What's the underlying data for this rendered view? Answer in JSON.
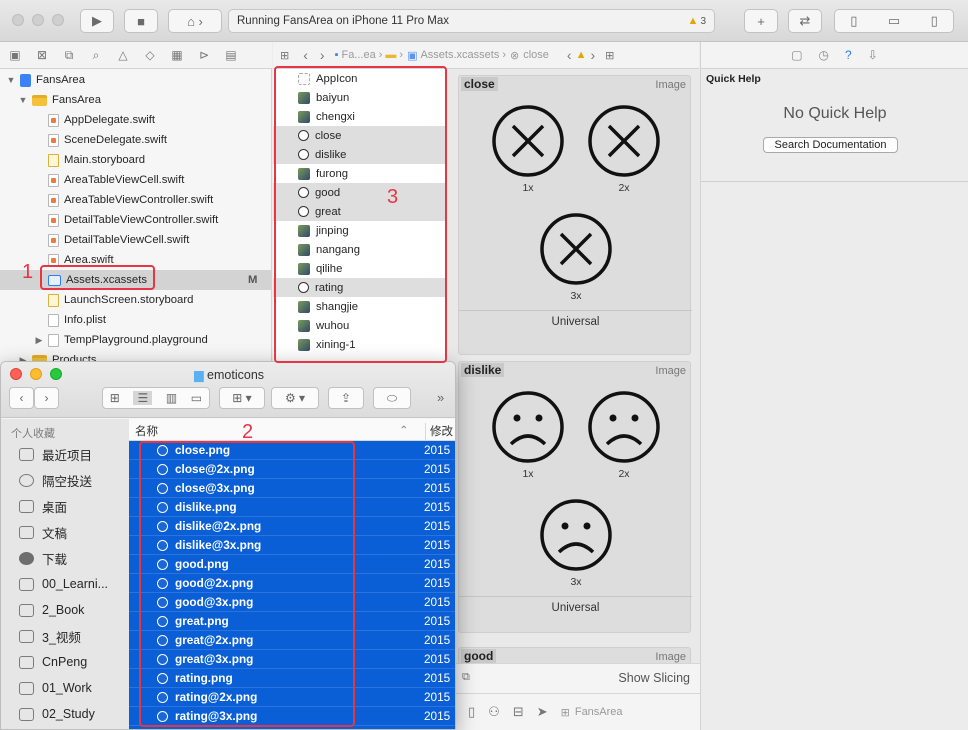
{
  "toolbar": {
    "status_text": "Running FansArea on iPhone 11 Pro Max",
    "warning_count": "3",
    "run_icon": "play-icon",
    "stop_icon": "stop-icon"
  },
  "navigator": {
    "items": [
      {
        "label": "FansArea",
        "kind": "project"
      },
      {
        "label": "FansArea",
        "kind": "group"
      },
      {
        "label": "AppDelegate.swift",
        "kind": "swift"
      },
      {
        "label": "SceneDelegate.swift",
        "kind": "swift"
      },
      {
        "label": "Main.storyboard",
        "kind": "storyboard"
      },
      {
        "label": "AreaTableViewCell.swift",
        "kind": "swift"
      },
      {
        "label": "AreaTableViewController.swift",
        "kind": "swift"
      },
      {
        "label": "DetailTableViewController.swift",
        "kind": "swift"
      },
      {
        "label": "DetailTableViewCell.swift",
        "kind": "swift"
      },
      {
        "label": "Area.swift",
        "kind": "swift"
      },
      {
        "label": "Assets.xcassets",
        "kind": "assets",
        "badge": "M"
      },
      {
        "label": "LaunchScreen.storyboard",
        "kind": "storyboard"
      },
      {
        "label": "Info.plist",
        "kind": "plist"
      },
      {
        "label": "TempPlayground.playground",
        "kind": "playground"
      },
      {
        "label": "Products",
        "kind": "group"
      }
    ]
  },
  "editor": {
    "breadcrumb": [
      "Fa...ea",
      "Assets.xcassets",
      "close"
    ]
  },
  "assets": [
    {
      "label": "AppIcon",
      "thumb": "blank"
    },
    {
      "label": "baiyun",
      "thumb": "img"
    },
    {
      "label": "chengxi",
      "thumb": "img"
    },
    {
      "label": "close",
      "thumb": "face",
      "highlight": true
    },
    {
      "label": "dislike",
      "thumb": "face",
      "highlight": true
    },
    {
      "label": "furong",
      "thumb": "img"
    },
    {
      "label": "good",
      "thumb": "face",
      "highlight": true
    },
    {
      "label": "great",
      "thumb": "face",
      "highlight": true
    },
    {
      "label": "jinping",
      "thumb": "img"
    },
    {
      "label": "nangang",
      "thumb": "img"
    },
    {
      "label": "qilihe",
      "thumb": "img"
    },
    {
      "label": "rating",
      "thumb": "face",
      "highlight": true
    },
    {
      "label": "shangjie",
      "thumb": "img"
    },
    {
      "label": "wuhou",
      "thumb": "img"
    },
    {
      "label": "xining-1",
      "thumb": "img"
    }
  ],
  "detail": {
    "sets": [
      {
        "name": "close",
        "type": "Image",
        "slots": [
          "1x",
          "2x",
          "3x"
        ],
        "scope": "Universal"
      },
      {
        "name": "dislike",
        "type": "Image",
        "slots": [
          "1x",
          "2x",
          "3x"
        ],
        "scope": "Universal"
      },
      {
        "name": "good",
        "type": "Image"
      }
    ],
    "show_slicing": "Show Slicing",
    "footer_project": "FansArea"
  },
  "inspector": {
    "title": "Quick Help",
    "empty_text": "No Quick Help",
    "search_button": "Search Documentation"
  },
  "finder": {
    "title": "emoticons",
    "sidebar_section": "个人收藏",
    "sidebar": [
      "最近项目",
      "隔空投送",
      "桌面",
      "文稿",
      "下载",
      "00_Learni...",
      "2_Book",
      "3_视频",
      "CnPeng",
      "01_Work",
      "02_Study"
    ],
    "columns": {
      "name": "名称",
      "date": "修改日"
    },
    "files": [
      {
        "name": "close.png",
        "date": "2015"
      },
      {
        "name": "close@2x.png",
        "date": "2015"
      },
      {
        "name": "close@3x.png",
        "date": "2015"
      },
      {
        "name": "dislike.png",
        "date": "2015"
      },
      {
        "name": "dislike@2x.png",
        "date": "2015"
      },
      {
        "name": "dislike@3x.png",
        "date": "2015"
      },
      {
        "name": "good.png",
        "date": "2015"
      },
      {
        "name": "good@2x.png",
        "date": "2015"
      },
      {
        "name": "good@3x.png",
        "date": "2015"
      },
      {
        "name": "great.png",
        "date": "2015"
      },
      {
        "name": "great@2x.png",
        "date": "2015"
      },
      {
        "name": "great@3x.png",
        "date": "2015"
      },
      {
        "name": "rating.png",
        "date": "2015"
      },
      {
        "name": "rating@2x.png",
        "date": "2015"
      },
      {
        "name": "rating@3x.png",
        "date": "2015"
      }
    ]
  },
  "annotations": [
    "1",
    "2",
    "3"
  ],
  "colors": {
    "selection_blue": "#0a5fd6",
    "annotation_red": "#e63646"
  }
}
